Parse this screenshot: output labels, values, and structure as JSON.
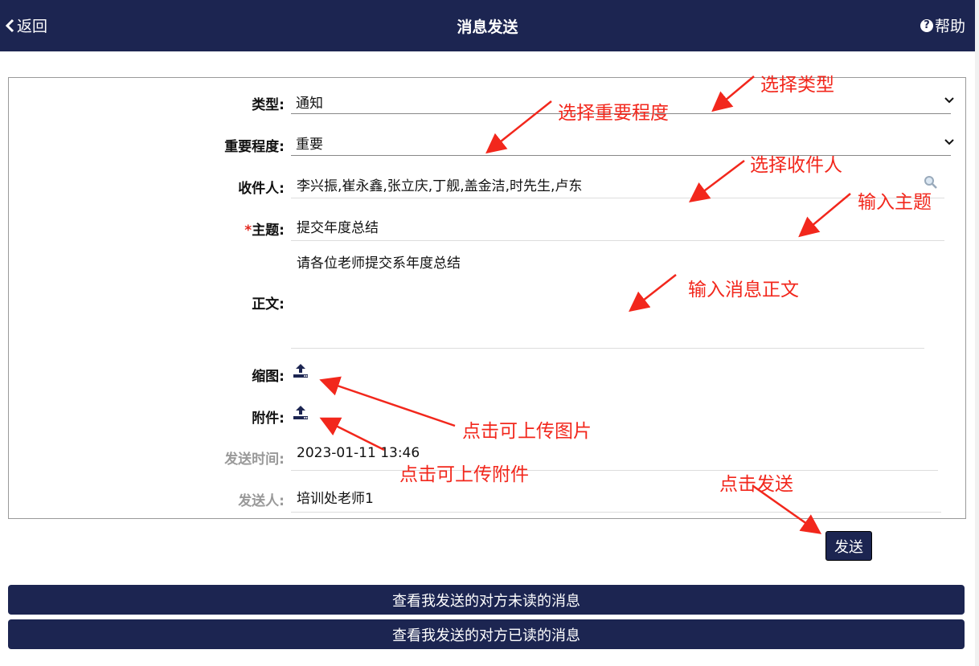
{
  "header": {
    "back_label": "返回",
    "title": "消息发送",
    "help_label": "帮助"
  },
  "form": {
    "type": {
      "label": "类型:",
      "value": "通知"
    },
    "importance": {
      "label": "重要程度:",
      "value": "重要"
    },
    "recipients": {
      "label": "收件人:",
      "value": "李兴振,崔永鑫,张立庆,丁舰,盖金洁,时先生,卢东"
    },
    "subject": {
      "required_mark": "*",
      "label": "主题:",
      "value": "提交年度总结"
    },
    "body": {
      "label": "正文:",
      "value": "请各位老师提交系年度总结"
    },
    "thumbnail": {
      "label": "缩图:"
    },
    "attachment": {
      "label": "附件:"
    },
    "send_time": {
      "label": "发送时间:",
      "value": "2023-01-11 13:46"
    },
    "sender": {
      "label": "发送人:",
      "value": "培训处老师1"
    }
  },
  "buttons": {
    "send": "发送",
    "unread": "查看我发送的对方未读的消息",
    "read": "查看我发送的对方已读的消息"
  },
  "annotations": {
    "select_type": "选择类型",
    "select_importance": "选择重要程度",
    "select_recipients": "选择收件人",
    "enter_subject": "输入主题",
    "enter_body": "输入消息正文",
    "upload_image": "点击可上传图片",
    "upload_attachment": "点击可上传附件",
    "click_send": "点击发送"
  },
  "colors": {
    "header_bg": "#1c2551",
    "annotation": "#f2271c",
    "required": "#e2261d"
  },
  "icons": [
    "chevron-left-icon",
    "help-circle-icon",
    "chevron-down-icon",
    "search-icon",
    "upload-icon"
  ]
}
